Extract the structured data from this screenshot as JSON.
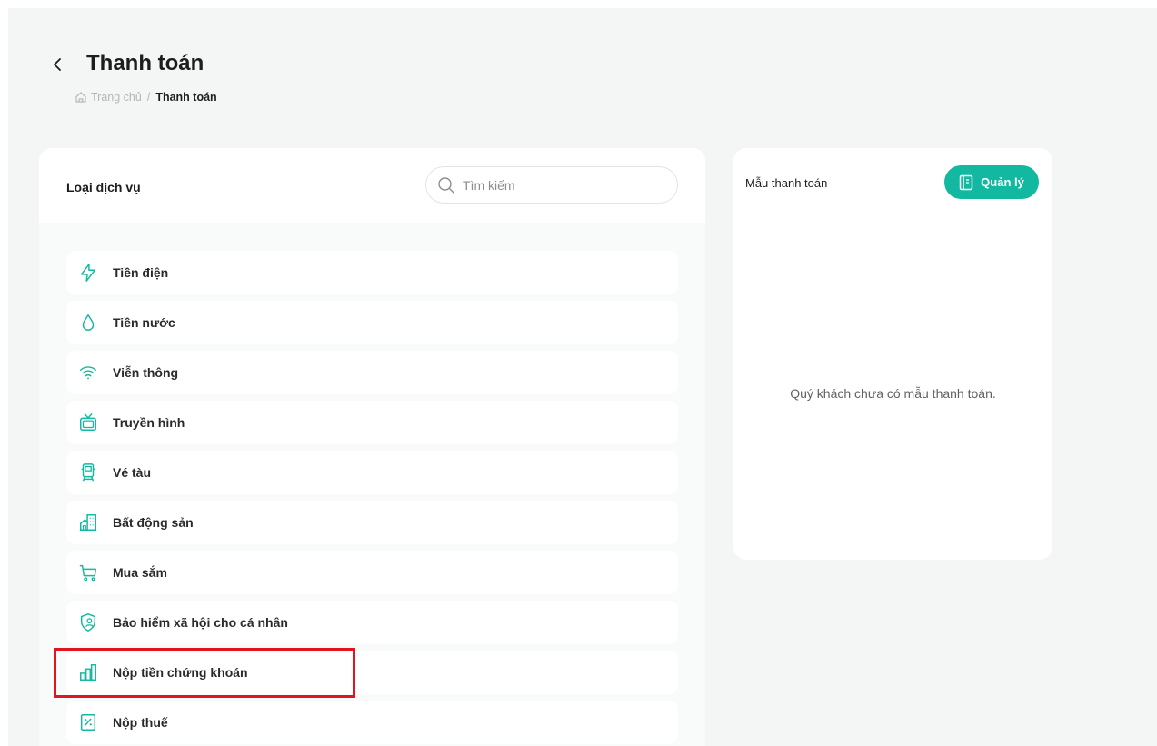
{
  "header": {
    "title": "Thanh toán",
    "breadcrumb": {
      "home": "Trang chủ",
      "separator": "/",
      "current": "Thanh toán"
    }
  },
  "services": {
    "title": "Loại dịch vụ",
    "search_placeholder": "Tìm kiếm",
    "items": [
      {
        "label": "Tiền điện",
        "icon": "lightning-icon"
      },
      {
        "label": "Tiền nước",
        "icon": "water-drop-icon"
      },
      {
        "label": "Viễn thông",
        "icon": "wifi-icon"
      },
      {
        "label": "Truyền hình",
        "icon": "tv-icon"
      },
      {
        "label": "Vé tàu",
        "icon": "train-icon"
      },
      {
        "label": "Bất động sản",
        "icon": "building-icon"
      },
      {
        "label": "Mua sắm",
        "icon": "shopping-cart-icon"
      },
      {
        "label": "Bảo hiểm xã hội cho cá nhân",
        "icon": "shield-user-icon"
      },
      {
        "label": "Nộp tiền chứng khoán",
        "icon": "stock-chart-icon"
      },
      {
        "label": "Nộp thuế",
        "icon": "tax-receipt-icon"
      }
    ]
  },
  "templates": {
    "title": "Mẫu thanh toán",
    "manage_label": "Quản lý",
    "empty_message": "Quý khách chưa có mẫu thanh toán."
  },
  "colors": {
    "accent": "#13b8a0",
    "highlight": "#e3141e",
    "background": "#f4f5f5"
  }
}
